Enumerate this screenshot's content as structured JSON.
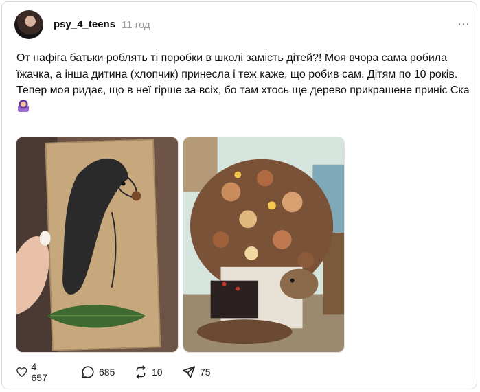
{
  "post": {
    "username": "psy_4_teens",
    "time": "11 год",
    "more_icon": "⋯",
    "text_lines": [
      "От нафіга батьки роблять ті поробки в школі замість дітей?! Моя вчора сама робила їжачка, а інша дитина (хлопчик) принесла і теж каже, що робив сам. Дітям по 10 років.",
      "Тепер моя ридає, що в неї гірше за всіх, бо там хтось ще дерево прикрашене приніс Ска"
    ],
    "emoji": "woman-facepalming-emoji"
  },
  "actions": {
    "likes": "4 657",
    "comments": "685",
    "reposts": "10",
    "shares": "75"
  },
  "colors": {
    "text": "#111111",
    "muted": "#9a9a9a",
    "border": "#d9d9d9"
  }
}
